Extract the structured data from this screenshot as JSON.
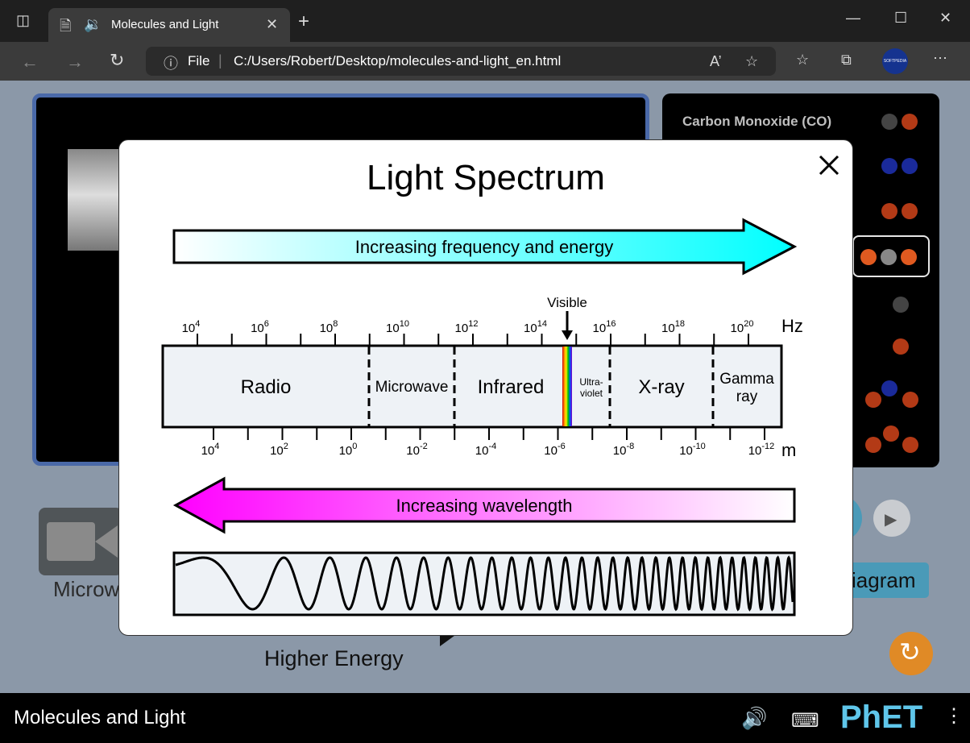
{
  "browser": {
    "tab_title": "Molecules and Light",
    "address_file": "File",
    "address_url": "C:/Users/Robert/Desktop/molecules-and-light_en.html",
    "profile_badge": "SOFTPEDIA"
  },
  "sim": {
    "molecule_selected_label": "Carbon Monoxide (CO)",
    "source_label": "Microw",
    "higher_energy": "Higher Energy",
    "diagram_button": "iagram",
    "title": "Molecules and Light",
    "phet_logo": "PhET"
  },
  "dialog": {
    "title": "Light Spectrum",
    "frequency_arrow": "Increasing frequency and energy",
    "wavelength_arrow": "Increasing wavelength",
    "visible_label": "Visible",
    "hz_unit": "Hz",
    "m_unit": "m",
    "bands": {
      "radio": "Radio",
      "microwave": "Microwave",
      "infrared": "Infrared",
      "ultraviolet_1": "Ultra-",
      "ultraviolet_2": "violet",
      "xray": "X-ray",
      "gamma_1": "Gamma",
      "gamma_2": "ray"
    },
    "freq_ticks": [
      {
        "base": "10",
        "exp": "4"
      },
      {
        "base": "10",
        "exp": "6"
      },
      {
        "base": "10",
        "exp": "8"
      },
      {
        "base": "10",
        "exp": "10"
      },
      {
        "base": "10",
        "exp": "12"
      },
      {
        "base": "10",
        "exp": "14"
      },
      {
        "base": "10",
        "exp": "16"
      },
      {
        "base": "10",
        "exp": "18"
      },
      {
        "base": "10",
        "exp": "20"
      }
    ],
    "wave_ticks": [
      {
        "base": "10",
        "exp": "4"
      },
      {
        "base": "10",
        "exp": "2"
      },
      {
        "base": "10",
        "exp": "0"
      },
      {
        "base": "10",
        "exp": "-2"
      },
      {
        "base": "10",
        "exp": "-4"
      },
      {
        "base": "10",
        "exp": "-6"
      },
      {
        "base": "10",
        "exp": "-8"
      },
      {
        "base": "10",
        "exp": "-10"
      },
      {
        "base": "10",
        "exp": "-12"
      }
    ]
  },
  "colors": {
    "freq_arrow_start": "#ffffff",
    "freq_arrow_end": "#00ffff",
    "wave_arrow_start": "#ff00ff",
    "wave_arrow_end": "#ffffff",
    "spectrum_bg": "#eef2f6",
    "sim_bg": "#8b98a8"
  }
}
